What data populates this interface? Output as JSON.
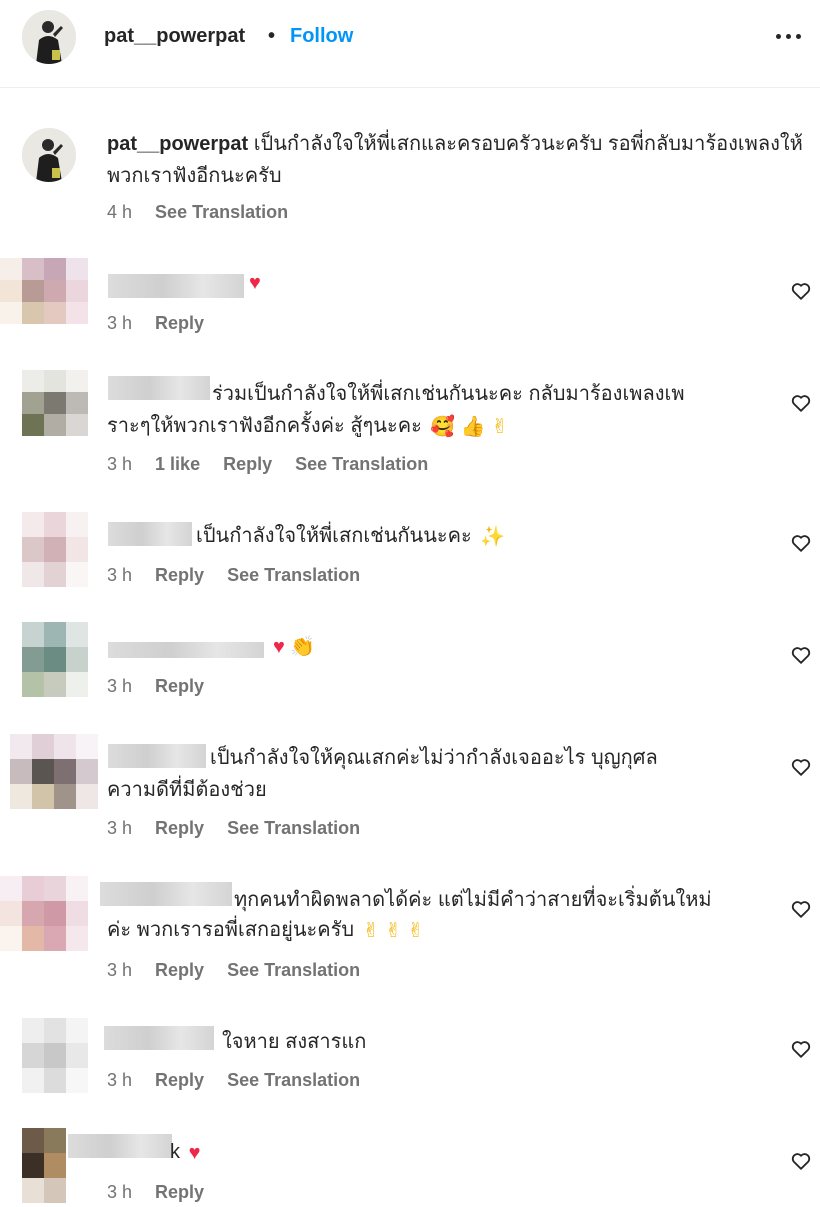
{
  "header": {
    "username": "pat__powerpat",
    "separator": "•",
    "follow_label": "Follow"
  },
  "caption": {
    "username": "pat__powerpat",
    "text": "เป็นกำลังใจให้พี่เสกและครอบครัวนะครับ รอพี่กลับมาร้องเพลงให้พวกเราฟังอีกนะครับ",
    "time": "4 h",
    "see_translation": "See Translation"
  },
  "comments": [
    {
      "line1": "",
      "line2": "",
      "emojis": "♥",
      "time": "3 h",
      "likes": "",
      "reply": "Reply",
      "see_translation": ""
    },
    {
      "line1": "ร่วมเป็นกำลังใจให้พี่เสกเช่นกันนะคะ กลับมาร้องเพลงเพ",
      "line2": "ราะๆให้พวกเราฟังอีกครั้งค่ะ สู้ๆนะคะ",
      "emojis": "🥰 👍 ✌",
      "time": "3 h",
      "likes": "1 like",
      "reply": "Reply",
      "see_translation": "See Translation"
    },
    {
      "line1": "เป็นกำลังใจให้พี่เสกเช่นกันนะคะ",
      "line2": "",
      "emojis": "✨",
      "time": "3 h",
      "likes": "",
      "reply": "Reply",
      "see_translation": "See Translation"
    },
    {
      "line1": "",
      "line2": "",
      "emojis": "♥ 👏",
      "time": "3 h",
      "likes": "",
      "reply": "Reply",
      "see_translation": ""
    },
    {
      "line1": "เป็นกำลังใจให้คุณเสกค่ะไม่ว่ากำลังเจออะไร บุญกุศล",
      "line2": "ความดีที่มีต้องช่วย",
      "emojis": "",
      "time": "3 h",
      "likes": "",
      "reply": "Reply",
      "see_translation": "See Translation"
    },
    {
      "line1": "ทุกคนทำผิดพลาดได้ค่ะ แต่ไม่มีคำว่าสายที่จะเริ่มต้นใหม่",
      "line2": "ค่ะ พวกเรารอพี่เสกอยู่นะครับ",
      "emojis": "✌ ✌ ✌",
      "time": "3 h",
      "likes": "",
      "reply": "Reply",
      "see_translation": "See Translation"
    },
    {
      "line1": "ใจหาย สงสารแก",
      "line2": "",
      "emojis": "",
      "time": "3 h",
      "likes": "",
      "reply": "Reply",
      "see_translation": "See Translation"
    },
    {
      "line1": "k",
      "line2": "",
      "emojis": "♥",
      "time": "3 h",
      "likes": "",
      "reply": "Reply",
      "see_translation": ""
    }
  ],
  "icons": {
    "more": "more-horizontal-icon",
    "like": "heart-outline-icon"
  },
  "colors": {
    "accent": "#0095f6",
    "text": "#262626",
    "secondary": "#737373",
    "heart_emoji": "#ed2849"
  }
}
